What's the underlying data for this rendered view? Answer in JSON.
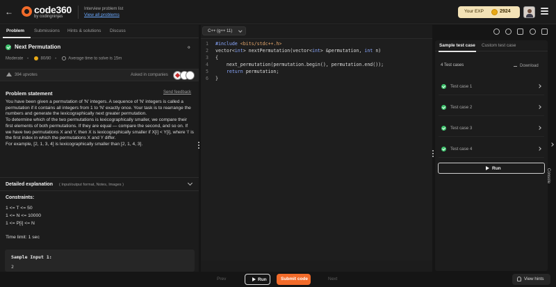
{
  "header": {
    "logo_text": "code360",
    "logo_sub": "by codingninjas",
    "crumb_title": "Interview problem list",
    "crumb_link": "View all problems",
    "exp_label": "Your EXP",
    "exp_value": "2924"
  },
  "left_tabs": [
    "Problem",
    "Submissions",
    "Hints & solutions",
    "Discuss"
  ],
  "problem": {
    "title": "Next Permutation",
    "difficulty": "Moderate",
    "score": "80/80",
    "avg_time": "Average time to solve is 15m",
    "upvotes": "394 upvotes",
    "asked_in": "Asked in companies"
  },
  "statement": {
    "heading": "Problem statement",
    "feedback": "Send feedback",
    "paragraphs": [
      "You have been given a permutation of 'N' integers. A sequence of 'N' integers is called a permutation if it contains all integers from 1 to 'N' exactly once. Your task is to rearrange the numbers and generate the lexicographically next greater permutation.",
      "To determine which of the two permutations is lexicographically smaller, we compare their first elements of both permutations. If they are equal — compare the second, and so on. If we have two permutations X and Y, then X is lexicographically smaller if X[i] < Y[i], where 'i' is the first index in which the permutations X and Y differ.",
      "For example, [2, 1, 3, 4] is lexicographically smaller than [2, 1, 4, 3]."
    ]
  },
  "detailed": {
    "title": "Detailed explanation",
    "subtitle": "( Input/output format, Notes, Images )"
  },
  "constraints": {
    "title": "Constraints:",
    "lines": [
      "1 <= T <= 50",
      "1 <= N <= 10000",
      "1 <= P[i] <= N"
    ],
    "time_limit": "Time limit: 1 sec"
  },
  "sample": {
    "title": "Sample Input 1:",
    "value": "2"
  },
  "editor": {
    "language": "C++ (g++ 11)",
    "lines": [
      {
        "n": "1",
        "code": "#include <bits/stdc++.h>"
      },
      {
        "n": "2",
        "code": "vector<int> nextPermutation(vector<int> &permutation, int n)"
      },
      {
        "n": "3",
        "code": "{"
      },
      {
        "n": "4",
        "code": "    next_permutation(permutation.begin(), permutation.end());"
      },
      {
        "n": "5",
        "code": "    return permutation;"
      },
      {
        "n": "6",
        "code": "}"
      }
    ]
  },
  "testpanel": {
    "tabs": [
      "Sample test case",
      "Custom test case"
    ],
    "count": "4 Test cases",
    "download": "Download",
    "cases": [
      "Test case 1",
      "Test case 2",
      "Test case 3",
      "Test case 4"
    ],
    "run": "Run",
    "console": "Console"
  },
  "footer": {
    "prev": "Prev",
    "run": "Run",
    "submit": "Submit code",
    "next": "Next",
    "hints": "View hints"
  },
  "colors": {
    "accent": "#f26b2a",
    "success": "#3ec46d",
    "link": "#6aa9ff"
  }
}
